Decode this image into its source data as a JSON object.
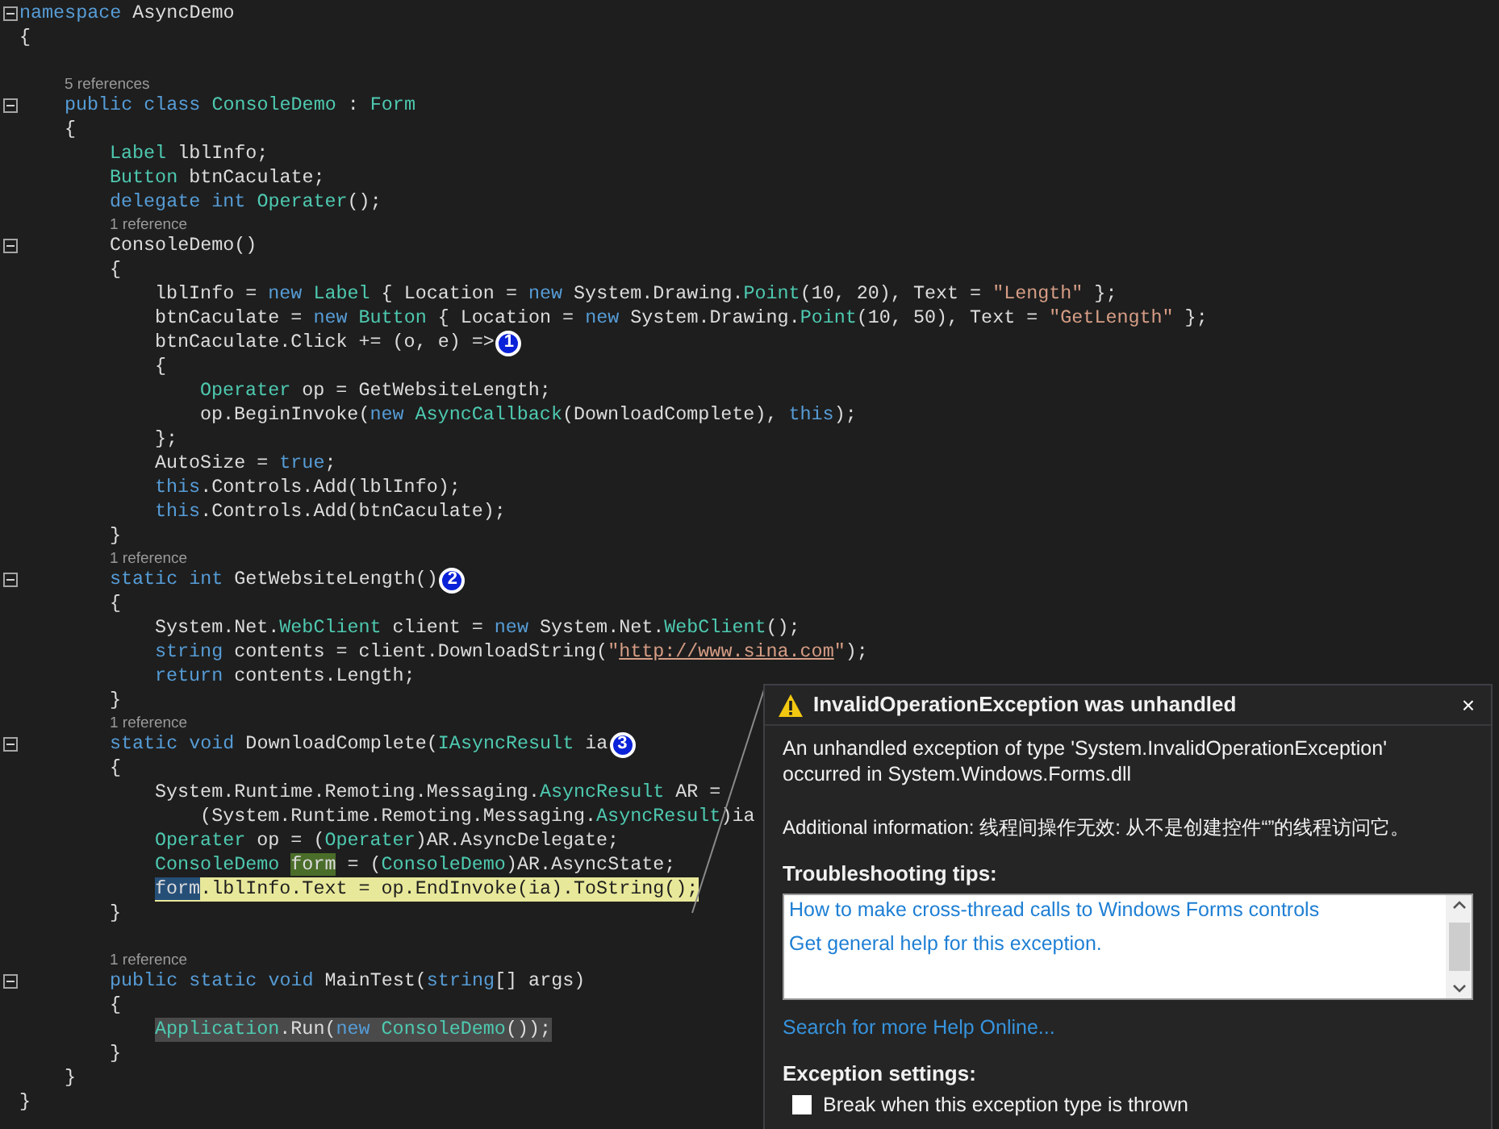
{
  "editor": {
    "lines": [
      {
        "kind": "code",
        "fold": true,
        "tokens": [
          {
            "kind": "kw",
            "text": "namespace"
          },
          {
            "kind": "plain",
            "text": " AsyncDemo"
          }
        ]
      },
      {
        "kind": "code",
        "tokens": [
          {
            "kind": "plain",
            "text": "{"
          }
        ]
      },
      {
        "kind": "block",
        "children": [
          {
            "kind": "blank"
          },
          {
            "kind": "lens",
            "text": "5 references"
          },
          {
            "kind": "code",
            "fold": true,
            "tokens": [
              {
                "kind": "kw",
                "text": "public "
              },
              {
                "kind": "kw",
                "text": "class "
              },
              {
                "kind": "type",
                "text": "ConsoleDemo"
              },
              {
                "kind": "plain",
                "text": " : "
              },
              {
                "kind": "type",
                "text": "Form"
              }
            ]
          },
          {
            "kind": "code",
            "tokens": [
              {
                "kind": "plain",
                "text": "{"
              }
            ]
          },
          {
            "kind": "block",
            "children": [
              {
                "kind": "code",
                "tokens": [
                  {
                    "kind": "type",
                    "text": "Label"
                  },
                  {
                    "kind": "plain",
                    "text": " lblInfo;"
                  }
                ]
              },
              {
                "kind": "code",
                "tokens": [
                  {
                    "kind": "type",
                    "text": "Button"
                  },
                  {
                    "kind": "plain",
                    "text": " btnCaculate;"
                  }
                ]
              },
              {
                "kind": "code",
                "tokens": [
                  {
                    "kind": "kw",
                    "text": "delegate "
                  },
                  {
                    "kind": "kw",
                    "text": "int "
                  },
                  {
                    "kind": "type",
                    "text": "Operater"
                  },
                  {
                    "kind": "plain",
                    "text": "();"
                  }
                ]
              },
              {
                "kind": "lens",
                "text": "1 reference"
              },
              {
                "kind": "code",
                "fold": true,
                "tokens": [
                  {
                    "kind": "plain",
                    "text": "ConsoleDemo()"
                  }
                ]
              },
              {
                "kind": "code",
                "tokens": [
                  {
                    "kind": "plain",
                    "text": "{"
                  }
                ]
              },
              {
                "kind": "block",
                "children": [
                  {
                    "kind": "code",
                    "tokens": [
                      {
                        "kind": "plain",
                        "text": "lblInfo = "
                      },
                      {
                        "kind": "kw",
                        "text": "new "
                      },
                      {
                        "kind": "type",
                        "text": "Label"
                      },
                      {
                        "kind": "plain",
                        "text": " { Location = "
                      },
                      {
                        "kind": "kw",
                        "text": "new"
                      },
                      {
                        "kind": "plain",
                        "text": " System.Drawing."
                      },
                      {
                        "kind": "type",
                        "text": "Point"
                      },
                      {
                        "kind": "plain",
                        "text": "(10, 20), Text = "
                      },
                      {
                        "kind": "str",
                        "text": "\"Length\""
                      },
                      {
                        "kind": "plain",
                        "text": " };"
                      }
                    ]
                  },
                  {
                    "kind": "code",
                    "tokens": [
                      {
                        "kind": "plain",
                        "text": "btnCaculate = "
                      },
                      {
                        "kind": "kw",
                        "text": "new "
                      },
                      {
                        "kind": "type",
                        "text": "Button"
                      },
                      {
                        "kind": "plain",
                        "text": " { Location = "
                      },
                      {
                        "kind": "kw",
                        "text": "new"
                      },
                      {
                        "kind": "plain",
                        "text": " System.Drawing."
                      },
                      {
                        "kind": "type",
                        "text": "Point"
                      },
                      {
                        "kind": "plain",
                        "text": "(10, 50), Text = "
                      },
                      {
                        "kind": "str",
                        "text": "\"GetLength\""
                      },
                      {
                        "kind": "plain",
                        "text": " };"
                      }
                    ]
                  },
                  {
                    "kind": "code",
                    "badge": "1",
                    "tokens": [
                      {
                        "kind": "plain",
                        "text": "btnCaculate.Click += (o, e) =>"
                      }
                    ]
                  },
                  {
                    "kind": "code",
                    "tokens": [
                      {
                        "kind": "plain",
                        "text": "{"
                      }
                    ]
                  },
                  {
                    "kind": "block",
                    "children": [
                      {
                        "kind": "code",
                        "tokens": [
                          {
                            "kind": "type",
                            "text": "Operater"
                          },
                          {
                            "kind": "plain",
                            "text": " op = GetWebsiteLength;"
                          }
                        ]
                      },
                      {
                        "kind": "code",
                        "tokens": [
                          {
                            "kind": "plain",
                            "text": "op.BeginInvoke("
                          },
                          {
                            "kind": "kw",
                            "text": "new "
                          },
                          {
                            "kind": "type",
                            "text": "AsyncCallback"
                          },
                          {
                            "kind": "plain",
                            "text": "(DownloadComplete), "
                          },
                          {
                            "kind": "kw",
                            "text": "this"
                          },
                          {
                            "kind": "plain",
                            "text": ");"
                          }
                        ]
                      }
                    ]
                  },
                  {
                    "kind": "code",
                    "tokens": [
                      {
                        "kind": "plain",
                        "text": "};"
                      }
                    ]
                  },
                  {
                    "kind": "code",
                    "tokens": [
                      {
                        "kind": "plain",
                        "text": "AutoSize = "
                      },
                      {
                        "kind": "kw",
                        "text": "true"
                      },
                      {
                        "kind": "plain",
                        "text": ";"
                      }
                    ]
                  },
                  {
                    "kind": "code",
                    "tokens": [
                      {
                        "kind": "kw",
                        "text": "this"
                      },
                      {
                        "kind": "plain",
                        "text": ".Controls.Add(lblInfo);"
                      }
                    ]
                  },
                  {
                    "kind": "code",
                    "tokens": [
                      {
                        "kind": "kw",
                        "text": "this"
                      },
                      {
                        "kind": "plain",
                        "text": ".Controls.Add(btnCaculate);"
                      }
                    ]
                  }
                ]
              },
              {
                "kind": "code",
                "tokens": [
                  {
                    "kind": "plain",
                    "text": "}"
                  }
                ]
              },
              {
                "kind": "lens",
                "text": "1 reference"
              },
              {
                "kind": "code",
                "fold": true,
                "badge": "2",
                "tokens": [
                  {
                    "kind": "kw",
                    "text": "static "
                  },
                  {
                    "kind": "kw",
                    "text": "int"
                  },
                  {
                    "kind": "plain",
                    "text": " GetWebsiteLength()"
                  }
                ]
              },
              {
                "kind": "code",
                "tokens": [
                  {
                    "kind": "plain",
                    "text": "{"
                  }
                ]
              },
              {
                "kind": "block",
                "children": [
                  {
                    "kind": "code",
                    "tokens": [
                      {
                        "kind": "plain",
                        "text": "System.Net."
                      },
                      {
                        "kind": "type",
                        "text": "WebClient"
                      },
                      {
                        "kind": "plain",
                        "text": " client = "
                      },
                      {
                        "kind": "kw",
                        "text": "new"
                      },
                      {
                        "kind": "plain",
                        "text": " System.Net."
                      },
                      {
                        "kind": "type",
                        "text": "WebClient"
                      },
                      {
                        "kind": "plain",
                        "text": "();"
                      }
                    ]
                  },
                  {
                    "kind": "code",
                    "tokens": [
                      {
                        "kind": "kw",
                        "text": "string"
                      },
                      {
                        "kind": "plain",
                        "text": " contents = client.DownloadString("
                      },
                      {
                        "kind": "str",
                        "text": "\""
                      },
                      {
                        "kind": "link",
                        "text": "http://www.sina.com"
                      },
                      {
                        "kind": "str",
                        "text": "\""
                      },
                      {
                        "kind": "plain",
                        "text": ");"
                      }
                    ]
                  },
                  {
                    "kind": "code",
                    "tokens": [
                      {
                        "kind": "kw",
                        "text": "return"
                      },
                      {
                        "kind": "plain",
                        "text": " contents.Length;"
                      }
                    ]
                  }
                ]
              },
              {
                "kind": "code",
                "tokens": [
                  {
                    "kind": "plain",
                    "text": "}"
                  }
                ]
              },
              {
                "kind": "lens",
                "text": "1 reference"
              },
              {
                "kind": "code",
                "fold": true,
                "badge": "3",
                "tokens": [
                  {
                    "kind": "kw",
                    "text": "static "
                  },
                  {
                    "kind": "kw",
                    "text": "void"
                  },
                  {
                    "kind": "plain",
                    "text": " DownloadComplete("
                  },
                  {
                    "kind": "type",
                    "text": "IAsyncResult"
                  },
                  {
                    "kind": "plain",
                    "text": " ia"
                  }
                ]
              },
              {
                "kind": "code",
                "tokens": [
                  {
                    "kind": "plain",
                    "text": "{"
                  }
                ]
              },
              {
                "kind": "block",
                "children": [
                  {
                    "kind": "code",
                    "tokens": [
                      {
                        "kind": "plain",
                        "text": "System.Runtime.Remoting.Messaging."
                      },
                      {
                        "kind": "type",
                        "text": "AsyncResult"
                      },
                      {
                        "kind": "plain",
                        "text": " AR ="
                      }
                    ]
                  },
                  {
                    "kind": "code",
                    "tokens": [
                      {
                        "kind": "plain",
                        "text": "    (System.Runtime.Remoting.Messaging."
                      },
                      {
                        "kind": "type",
                        "text": "AsyncResult"
                      },
                      {
                        "kind": "plain",
                        "text": ")ia"
                      }
                    ]
                  },
                  {
                    "kind": "code",
                    "tokens": [
                      {
                        "kind": "type",
                        "text": "Operater"
                      },
                      {
                        "kind": "plain",
                        "text": " op = ("
                      },
                      {
                        "kind": "type",
                        "text": "Operater"
                      },
                      {
                        "kind": "plain",
                        "text": ")AR.AsyncDelegate;"
                      }
                    ]
                  },
                  {
                    "kind": "code",
                    "tokens": [
                      {
                        "kind": "type",
                        "text": "ConsoleDemo "
                      },
                      {
                        "kind": "plain",
                        "text": "form",
                        "highlighted": true
                      },
                      {
                        "kind": "plain",
                        "text": " = ("
                      },
                      {
                        "kind": "type",
                        "text": "ConsoleDemo"
                      },
                      {
                        "kind": "plain",
                        "text": ")AR.AsyncState;"
                      }
                    ]
                  },
                  {
                    "kind": "code",
                    "current_statement": true,
                    "tokens": [
                      {
                        "kind": "plain",
                        "text": "form",
                        "selected": true
                      },
                      {
                        "kind": "plain",
                        "text": ".lblInfo.Text = op.EndInvoke(ia).ToString();"
                      }
                    ]
                  }
                ]
              },
              {
                "kind": "code",
                "tokens": [
                  {
                    "kind": "plain",
                    "text": "}"
                  }
                ]
              },
              {
                "kind": "blank"
              },
              {
                "kind": "lens",
                "text": "1 reference"
              },
              {
                "kind": "code",
                "fold": true,
                "tokens": [
                  {
                    "kind": "kw",
                    "text": "public "
                  },
                  {
                    "kind": "kw",
                    "text": "static "
                  },
                  {
                    "kind": "kw",
                    "text": "void"
                  },
                  {
                    "kind": "plain",
                    "text": " MainTest("
                  },
                  {
                    "kind": "kw",
                    "text": "string"
                  },
                  {
                    "kind": "plain",
                    "text": "[] args)"
                  }
                ]
              },
              {
                "kind": "code",
                "tokens": [
                  {
                    "kind": "plain",
                    "text": "{"
                  }
                ]
              },
              {
                "kind": "block",
                "children": [
                  {
                    "kind": "code",
                    "call_stack_frame": true,
                    "tokens": [
                      {
                        "kind": "type",
                        "text": "Application"
                      },
                      {
                        "kind": "plain",
                        "text": ".Run("
                      },
                      {
                        "kind": "kw",
                        "text": "new "
                      },
                      {
                        "kind": "type",
                        "text": "ConsoleDemo"
                      },
                      {
                        "kind": "plain",
                        "text": "());"
                      }
                    ]
                  }
                ]
              },
              {
                "kind": "code",
                "tokens": [
                  {
                    "kind": "plain",
                    "text": "}"
                  }
                ]
              }
            ]
          },
          {
            "kind": "code",
            "tokens": [
              {
                "kind": "plain",
                "text": "}"
              }
            ]
          }
        ]
      },
      {
        "kind": "code",
        "tokens": [
          {
            "kind": "plain",
            "text": "}"
          }
        ]
      }
    ]
  },
  "exception_popup": {
    "title": "InvalidOperationException was unhandled",
    "close": "×",
    "message": "An unhandled exception of type 'System.InvalidOperationException' occurred in System.Windows.Forms.dll",
    "additional_info": "Additional information: 线程间操作无效: 从不是创建控件“”的线程访问它。",
    "tips_heading": "Troubleshooting tips:",
    "tips": [
      "How to make cross-thread calls to Windows Forms controls",
      "Get general help for this exception."
    ],
    "search_link": "Search for more Help Online...",
    "settings_heading": "Exception settings:",
    "settings": [
      {
        "label": "Break when this exception type is thrown",
        "checked": false
      }
    ]
  }
}
